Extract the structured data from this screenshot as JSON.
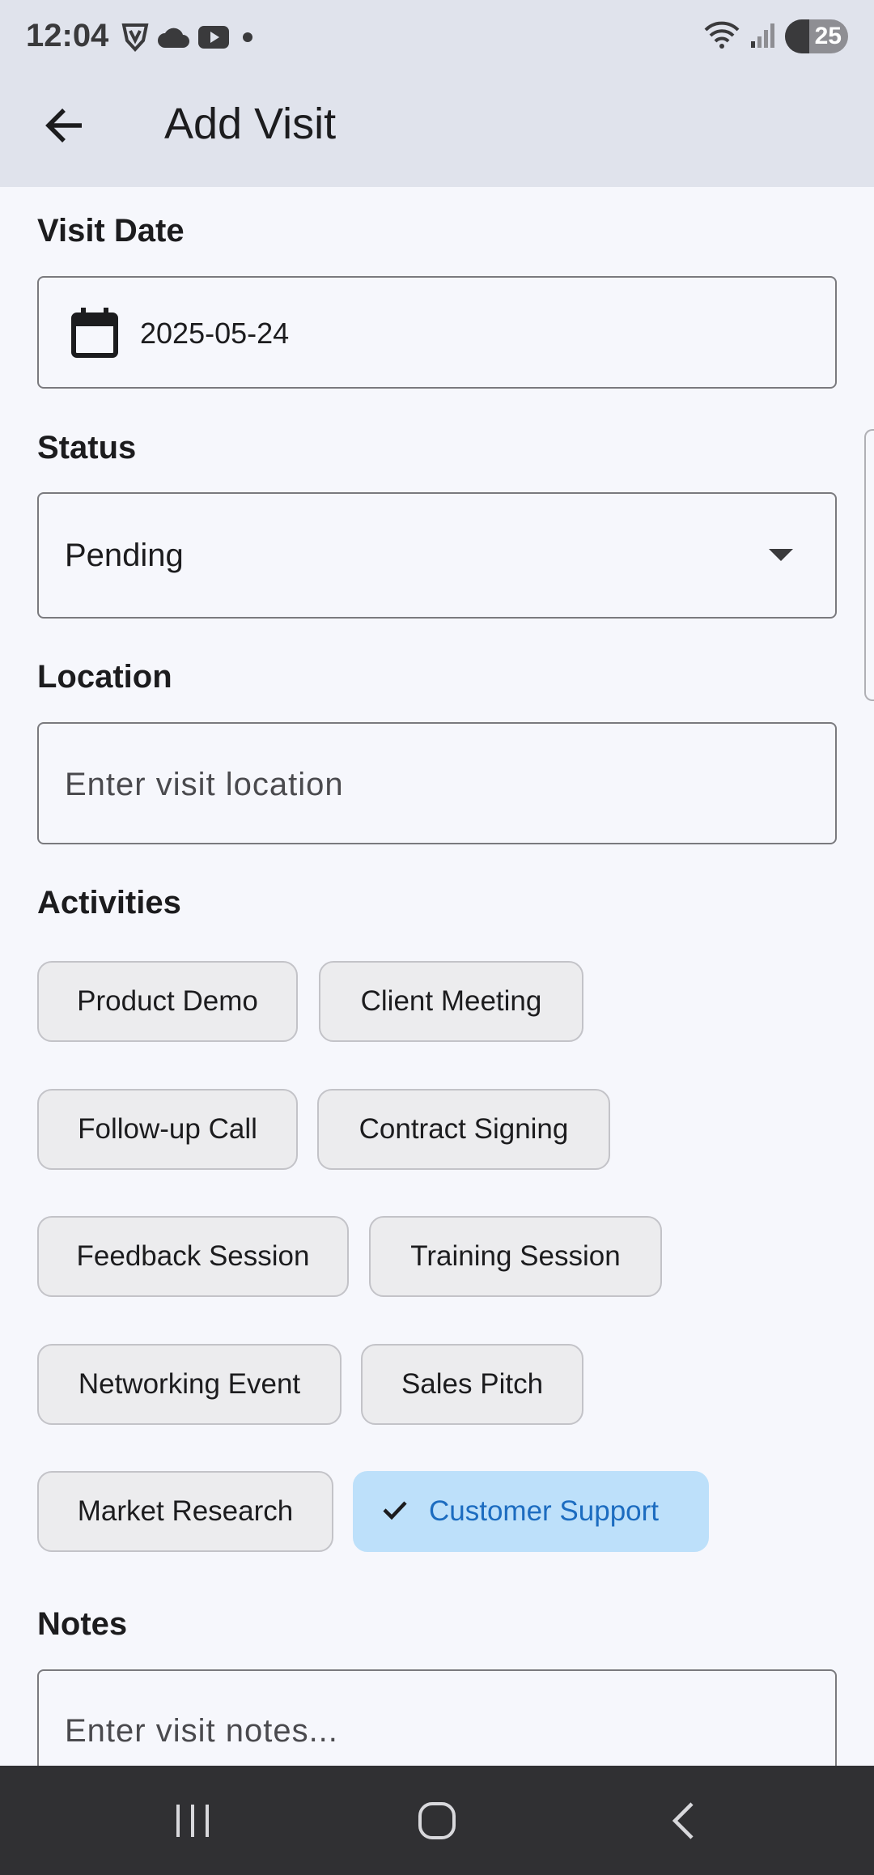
{
  "status_bar": {
    "time": "12:04",
    "battery_level": "25"
  },
  "app_bar": {
    "title": "Add Visit"
  },
  "visit_date": {
    "label": "Visit Date",
    "value": "2025-05-24"
  },
  "status": {
    "label": "Status",
    "value": "Pending"
  },
  "location": {
    "label": "Location",
    "placeholder": "Enter visit location"
  },
  "activities": {
    "label": "Activities",
    "chips": [
      {
        "label": "Product Demo",
        "selected": false
      },
      {
        "label": "Client Meeting",
        "selected": false
      },
      {
        "label": "Follow-up Call",
        "selected": false
      },
      {
        "label": "Contract Signing",
        "selected": false
      },
      {
        "label": "Feedback Session",
        "selected": false
      },
      {
        "label": "Training Session",
        "selected": false
      },
      {
        "label": "Networking Event",
        "selected": false
      },
      {
        "label": "Sales Pitch",
        "selected": false
      },
      {
        "label": "Market Research",
        "selected": false
      },
      {
        "label": "Customer Support",
        "selected": true
      }
    ]
  },
  "notes": {
    "label": "Notes",
    "placeholder": "Enter visit notes..."
  },
  "colors": {
    "app_bar_bg": "#e0e3ec",
    "page_bg": "#f6f7fc",
    "chip_bg": "#ececee",
    "chip_selected_bg": "#bde0fa",
    "chip_selected_text": "#1c6cc0",
    "nav_bar_bg": "#303033"
  }
}
